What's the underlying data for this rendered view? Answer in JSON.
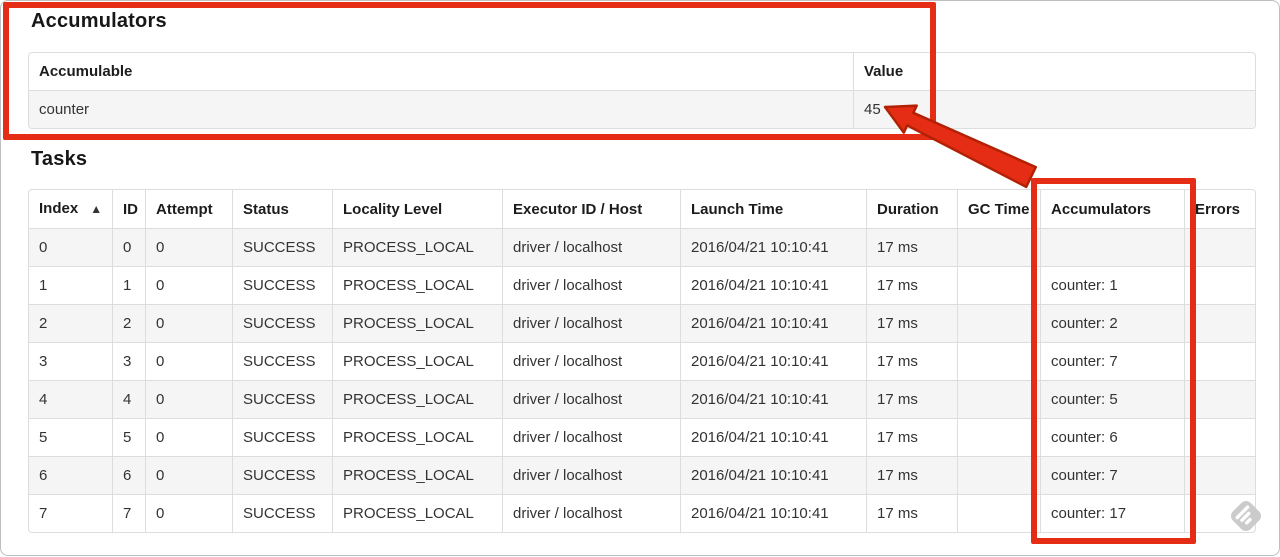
{
  "colors": {
    "annotation_red": "#e42d14",
    "annotation_red_dark": "#b32105",
    "watermark_gray": "#cbcbcb"
  },
  "accumulators_section": {
    "title": "Accumulators",
    "table": {
      "headers": [
        "Accumulable",
        "Value"
      ],
      "rows": [
        [
          "counter",
          "45"
        ]
      ]
    }
  },
  "tasks_section": {
    "title": "Tasks",
    "table": {
      "sort_icon": "▲",
      "headers": [
        "Index",
        "ID",
        "Attempt",
        "Status",
        "Locality Level",
        "Executor ID / Host",
        "Launch Time",
        "Duration",
        "GC Time",
        "Accumulators",
        "Errors"
      ],
      "rows": [
        [
          "0",
          "0",
          "0",
          "SUCCESS",
          "PROCESS_LOCAL",
          "driver / localhost",
          "2016/04/21 10:10:41",
          "17 ms",
          "",
          "",
          ""
        ],
        [
          "1",
          "1",
          "0",
          "SUCCESS",
          "PROCESS_LOCAL",
          "driver / localhost",
          "2016/04/21 10:10:41",
          "17 ms",
          "",
          "counter: 1",
          ""
        ],
        [
          "2",
          "2",
          "0",
          "SUCCESS",
          "PROCESS_LOCAL",
          "driver / localhost",
          "2016/04/21 10:10:41",
          "17 ms",
          "",
          "counter: 2",
          ""
        ],
        [
          "3",
          "3",
          "0",
          "SUCCESS",
          "PROCESS_LOCAL",
          "driver / localhost",
          "2016/04/21 10:10:41",
          "17 ms",
          "",
          "counter: 7",
          ""
        ],
        [
          "4",
          "4",
          "0",
          "SUCCESS",
          "PROCESS_LOCAL",
          "driver / localhost",
          "2016/04/21 10:10:41",
          "17 ms",
          "",
          "counter: 5",
          ""
        ],
        [
          "5",
          "5",
          "0",
          "SUCCESS",
          "PROCESS_LOCAL",
          "driver / localhost",
          "2016/04/21 10:10:41",
          "17 ms",
          "",
          "counter: 6",
          ""
        ],
        [
          "6",
          "6",
          "0",
          "SUCCESS",
          "PROCESS_LOCAL",
          "driver / localhost",
          "2016/04/21 10:10:41",
          "17 ms",
          "",
          "counter: 7",
          ""
        ],
        [
          "7",
          "7",
          "0",
          "SUCCESS",
          "PROCESS_LOCAL",
          "driver / localhost",
          "2016/04/21 10:10:41",
          "17 ms",
          "",
          "counter: 17",
          ""
        ]
      ]
    }
  }
}
